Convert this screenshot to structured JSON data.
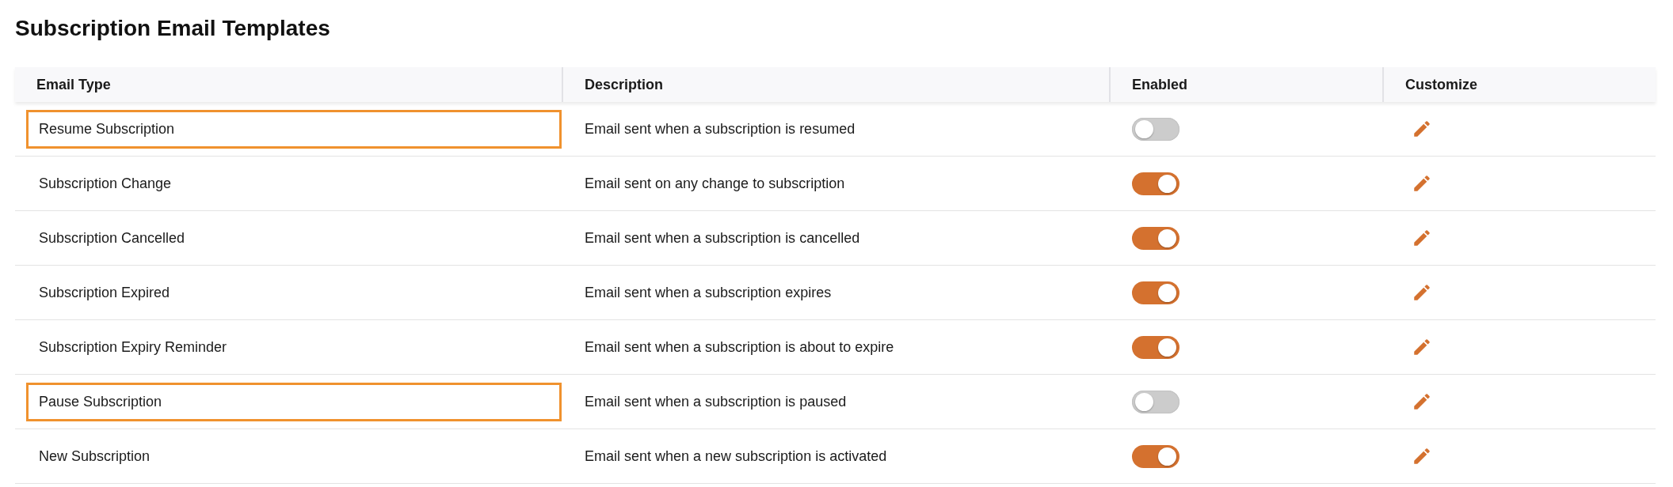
{
  "title": "Subscription Email Templates",
  "columns": [
    "Email Type",
    "Description",
    "Enabled",
    "Customize"
  ],
  "rows": [
    {
      "email_type": "Resume Subscription",
      "description": "Email sent when a subscription is resumed",
      "enabled": false,
      "highlighted": true
    },
    {
      "email_type": "Subscription Change",
      "description": "Email sent on any change to subscription",
      "enabled": true,
      "highlighted": false
    },
    {
      "email_type": "Subscription Cancelled",
      "description": "Email sent when a subscription is cancelled",
      "enabled": true,
      "highlighted": false
    },
    {
      "email_type": "Subscription Expired",
      "description": "Email sent when a subscription expires",
      "enabled": true,
      "highlighted": false
    },
    {
      "email_type": "Subscription Expiry Reminder",
      "description": "Email sent when a subscription is about to expire",
      "enabled": true,
      "highlighted": false
    },
    {
      "email_type": "Pause Subscription",
      "description": "Email sent when a subscription is paused",
      "enabled": false,
      "highlighted": true
    },
    {
      "email_type": "New Subscription",
      "description": "Email sent when a new subscription is activated",
      "enabled": true,
      "highlighted": false
    }
  ]
}
